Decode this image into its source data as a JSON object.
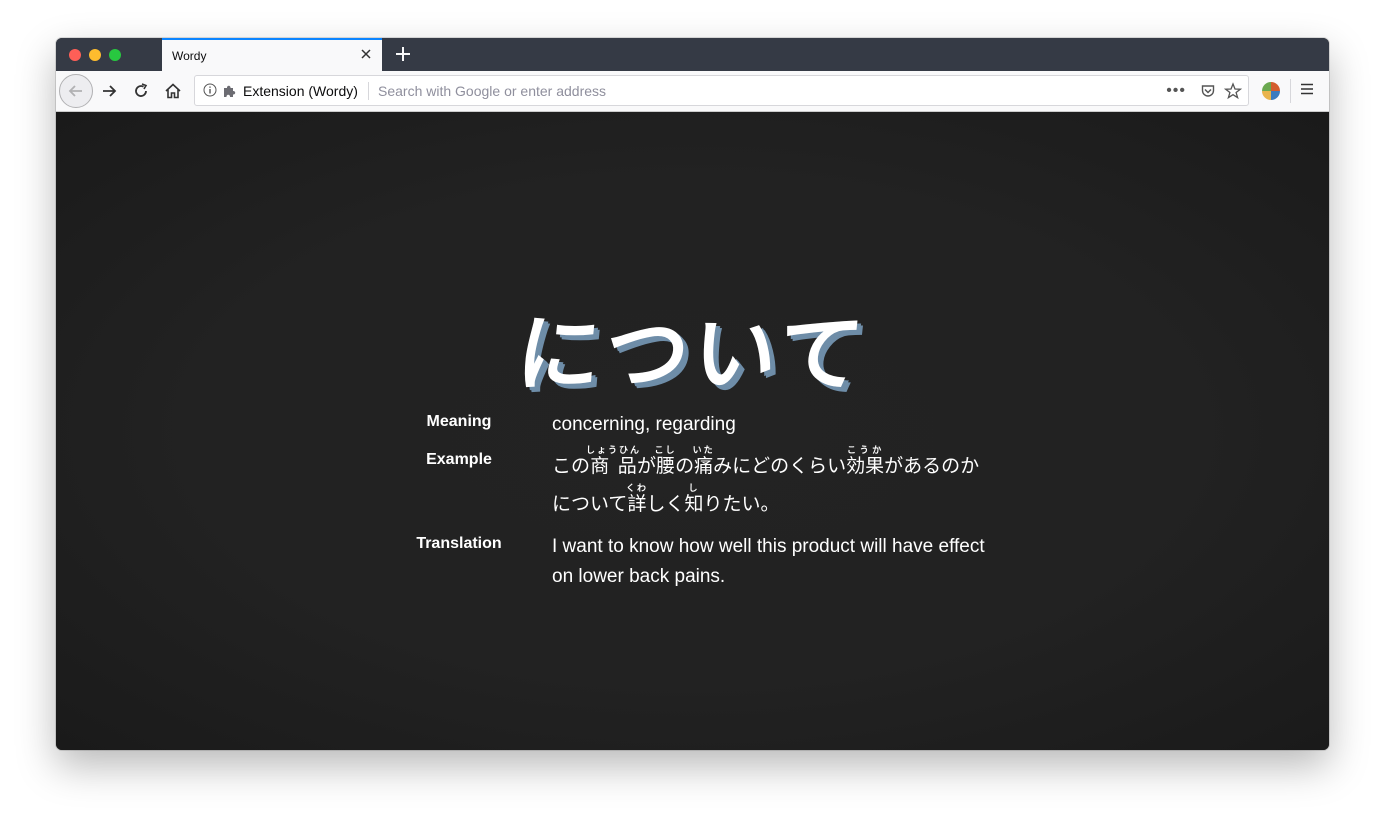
{
  "browser": {
    "tab": {
      "title": "Wordy"
    },
    "urlbar": {
      "identity": "Extension (Wordy)",
      "placeholder": "Search with Google or enter address"
    }
  },
  "card": {
    "word": "について",
    "meaning_label": "Meaning",
    "meaning": "concerning, regarding",
    "example_label": "Example",
    "example": [
      {
        "t": "この"
      },
      {
        "t": "商品",
        "r": "しょうひん"
      },
      {
        "t": "が"
      },
      {
        "t": "腰",
        "r": "こし"
      },
      {
        "t": "の"
      },
      {
        "t": "痛",
        "r": "いた"
      },
      {
        "t": "みにどのくらい"
      },
      {
        "t": "効果",
        "r": "こうか"
      },
      {
        "t": "があるのかについて"
      },
      {
        "t": "詳",
        "r": "くわ"
      },
      {
        "t": "しく"
      },
      {
        "t": "知",
        "r": "し"
      },
      {
        "t": "りたい。"
      }
    ],
    "translation_label": "Translation",
    "translation": "I want to know how well this product will have effect on lower back pains."
  }
}
